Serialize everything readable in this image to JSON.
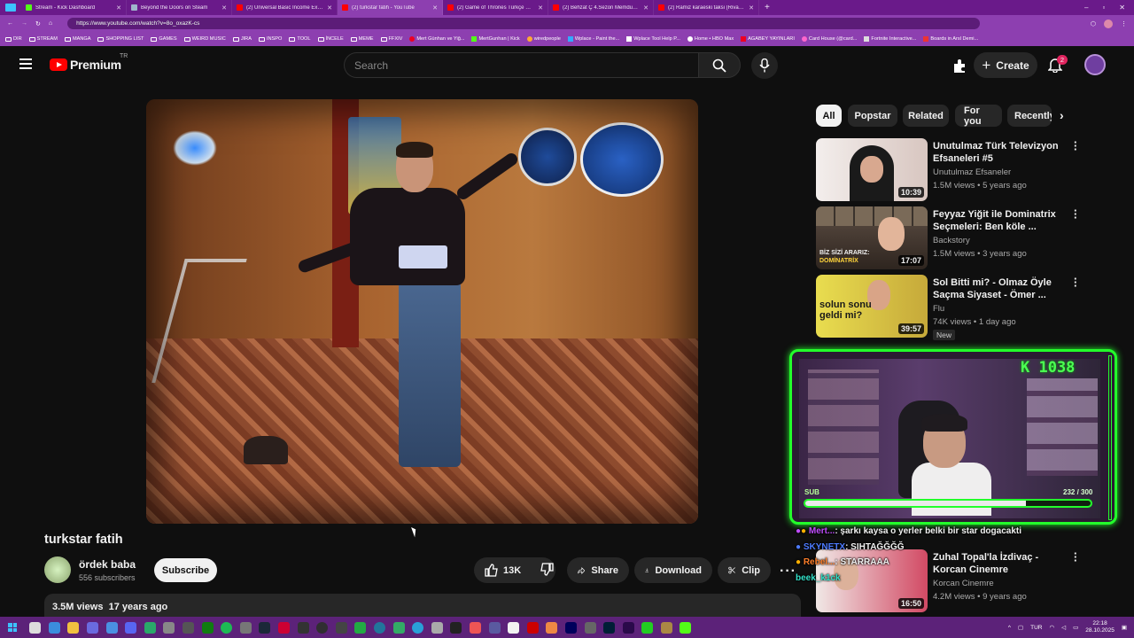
{
  "browser": {
    "tabs": [
      {
        "title": "Stream - Kick Dashboard",
        "color": "#53fc18"
      },
      {
        "title": "Beyond the Doors on Steam",
        "color": "#1b2838"
      },
      {
        "title": "(2) Universal Basic Income Explai...",
        "color": "#ff0000"
      },
      {
        "title": "(2) turkstar fatih - YouTube",
        "color": "#ff0000"
      },
      {
        "title": "(2) Game of Thrones Türkçe Dubl...",
        "color": "#ff0000"
      },
      {
        "title": "(2) Behzat Ç 4.Sezon Memduh Ba...",
        "color": "#ff0000"
      },
      {
        "title": "(2) Ramiz karaeski taksi (Rivayet...",
        "color": "#ff0000"
      }
    ],
    "url": "https://www.youtube.com/watch?v=8o_oxazK-cs",
    "bookmarks": [
      "DIR",
      "STREAM",
      "MANGA",
      "SHOPPING LIST",
      "GAMES",
      "WEIRD MUSIC",
      "JIRA",
      "INSPO",
      "TOOL",
      "İNCELE",
      "MEME",
      "FFXIV",
      "Mert Günhan ve Yiğ...",
      "MertGunhan | Kick",
      "wiredpeople",
      "Wplace - Paint the...",
      "Wplace Tool Help P...",
      "Home • HBO Max",
      "AGABEY YAYINLARI",
      "Card House (@card...",
      "Fortnite Interactive...",
      "Boards in Arsl Demi..."
    ]
  },
  "header": {
    "logo_text": "Premium",
    "region": "TR",
    "search_placeholder": "Search",
    "create_label": "Create",
    "notifications_count": "2"
  },
  "video": {
    "title": "turkstar fatih",
    "channel": "ördek baba",
    "subscribers": "556 subscribers",
    "subscribe_label": "Subscribe",
    "likes": "13K",
    "share_label": "Share",
    "download_label": "Download",
    "clip_label": "Clip",
    "views": "3.5M views",
    "age": "17 years ago"
  },
  "chips": [
    "All",
    "Popstar",
    "Related",
    "For you",
    "Recently"
  ],
  "recommendations": [
    {
      "title": "Unutulmaz Türk Televizyon Efsaneleri #5",
      "channel": "Unutulmaz Efsaneler",
      "meta": "1.5M views • 5 years ago",
      "duration": "10:39",
      "color": "#e8dcd6"
    },
    {
      "title": "Feyyaz Yiğit ile Dominatrix Seçmeleri: Ben köle ...",
      "channel": "Backstory",
      "meta": "1.5M views • 3 years ago",
      "duration": "17:07",
      "overlay": "BİZ SİZİ ARARIZ:",
      "overlay2": "DOMİNATRİX",
      "color": "#6b5a4a"
    },
    {
      "title": "Sol Bitti mi? - Olmaz Öyle Saçma Siyaset - Ömer ...",
      "channel": "Flu",
      "meta": "74K views • 1 day ago",
      "new_badge": "New",
      "duration": "39:57",
      "overlay": "solun sonu geldi mi?",
      "color": "#f1e24a"
    },
    {
      "title": "Zuhal Topal'la İzdivaç - Korcan Cinemre",
      "channel": "Korcan Cinemre",
      "meta": "4.2M views • 9 years ago",
      "duration": "16:50",
      "color": "#c03a55"
    }
  ],
  "stream": {
    "follower_count": "K 1038",
    "sub_label": "SUB",
    "sub_current": 232,
    "sub_goal": 300,
    "sub_text": "232 / 300"
  },
  "chat": [
    {
      "user": "Mert...",
      "text": ": şarkı kaysa o yerler belki bir star dogacakti",
      "color": "#c14dff"
    },
    {
      "user": "SKYNETX",
      "text": ": SIHTAĞĞĞĞ",
      "color": "#4d7bff"
    },
    {
      "user": "Rebel...",
      "text": ": STARRAAA",
      "color": "#ff7f2a"
    },
    {
      "user": "beek_k1ck",
      "text": "",
      "color": "#33e0c8"
    }
  ],
  "taskbar": {
    "lang": "TUR",
    "time": "22:18",
    "date": "28.10.2025"
  }
}
